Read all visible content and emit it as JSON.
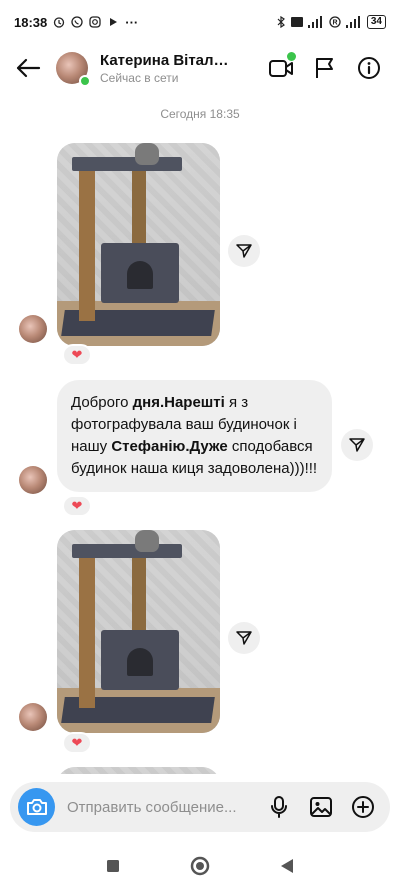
{
  "status_bar": {
    "time": "18:38",
    "battery": "34"
  },
  "header": {
    "contact_name": "Катерина Віталі...",
    "contact_status": "Сейчас в сети"
  },
  "chat": {
    "timestamp": "Сегодня 18:35",
    "text_message": {
      "segments": [
        {
          "text": "Доброго ",
          "bold": false
        },
        {
          "text": "дня.Нарешті",
          "bold": true
        },
        {
          "text": " я з фотографувала ваш будиночок і нашу ",
          "bold": false
        },
        {
          "text": "Стефанію.Дуже",
          "bold": true
        },
        {
          "text": " сподобався  будинок наша киця задоволена)))!!!",
          "bold": false
        }
      ]
    },
    "reaction": "❤"
  },
  "composer": {
    "placeholder": "Отправить сообщение..."
  },
  "colors": {
    "accent": "#3797f0",
    "online": "#3bc44b",
    "heart": "#ed4956"
  }
}
